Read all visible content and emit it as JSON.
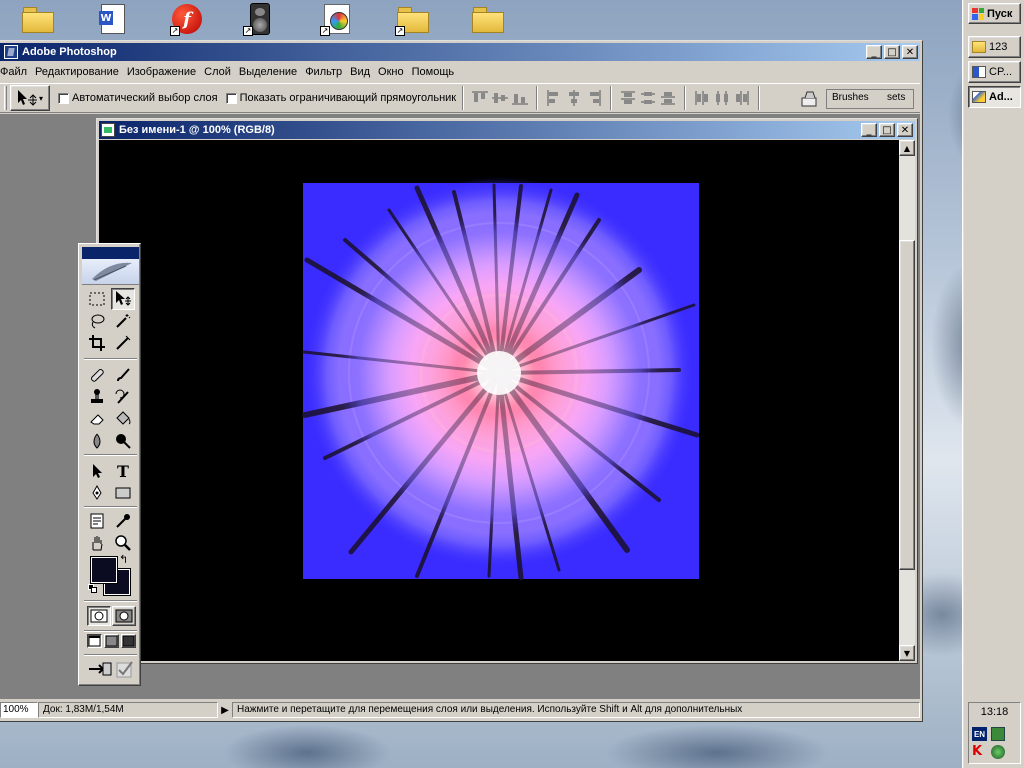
{
  "taskbar": {
    "start_label": "Пуск",
    "tasks": [
      {
        "label": "123"
      },
      {
        "label": "CP..."
      },
      {
        "label": "Ad..."
      }
    ]
  },
  "tray": {
    "clock": "13:18",
    "lang": "EN"
  },
  "window": {
    "title": "Adobe Photoshop",
    "menu": [
      "Файл",
      "Редактирование",
      "Изображение",
      "Слой",
      "Выделение",
      "Фильтр",
      "Вид",
      "Окно",
      "Помощь"
    ]
  },
  "options": {
    "auto_select": "Автоматический выбор слоя",
    "show_bounds": "Показать ограничивающий прямоугольник",
    "brushes_tab": "Brushes",
    "presets_tab": "sets"
  },
  "document": {
    "title": "Без имени-1 @ 100% (RGB/8)"
  },
  "status": {
    "zoom": "100%",
    "doc": "Док: 1,83M/1,54M",
    "hint": "Нажмите и перетащите для перемещения слоя или выделения. Используйте Shift и Alt для дополнительных"
  },
  "colors": {
    "title_bar_start": "#0a246a",
    "title_bar_end": "#a6caf0",
    "image_bg": "#3a2cff",
    "foreground": "#0b0b22",
    "background": "#0b0b22"
  }
}
